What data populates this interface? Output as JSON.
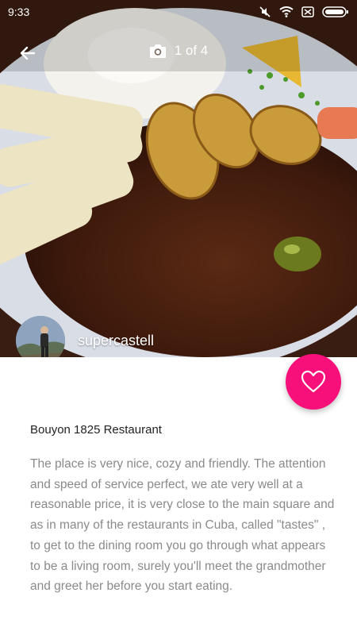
{
  "status_bar": {
    "time": "9:33",
    "icons": [
      "mute-icon",
      "wifi-icon",
      "sim-icon",
      "battery-icon"
    ]
  },
  "gallery": {
    "counter": "1 of 4",
    "icon": "camera-icon"
  },
  "author": {
    "username": "supercastell"
  },
  "place": {
    "name": "Bouyon 1825 Restaurant"
  },
  "review": {
    "text": "The place is very nice, cozy and friendly. The attention and speed of service perfect, we ate very well at a reasonable price, it is very close to the main square and as in many of the restaurants in Cuba, called \"tastes\" , to get to the dining room you go through what appears to be a living room, surely you'll meet the grandmother and greet her before you start eating."
  },
  "colors": {
    "accent": "#f7107a",
    "text_primary": "#222222",
    "text_secondary": "#8a8a8a"
  }
}
